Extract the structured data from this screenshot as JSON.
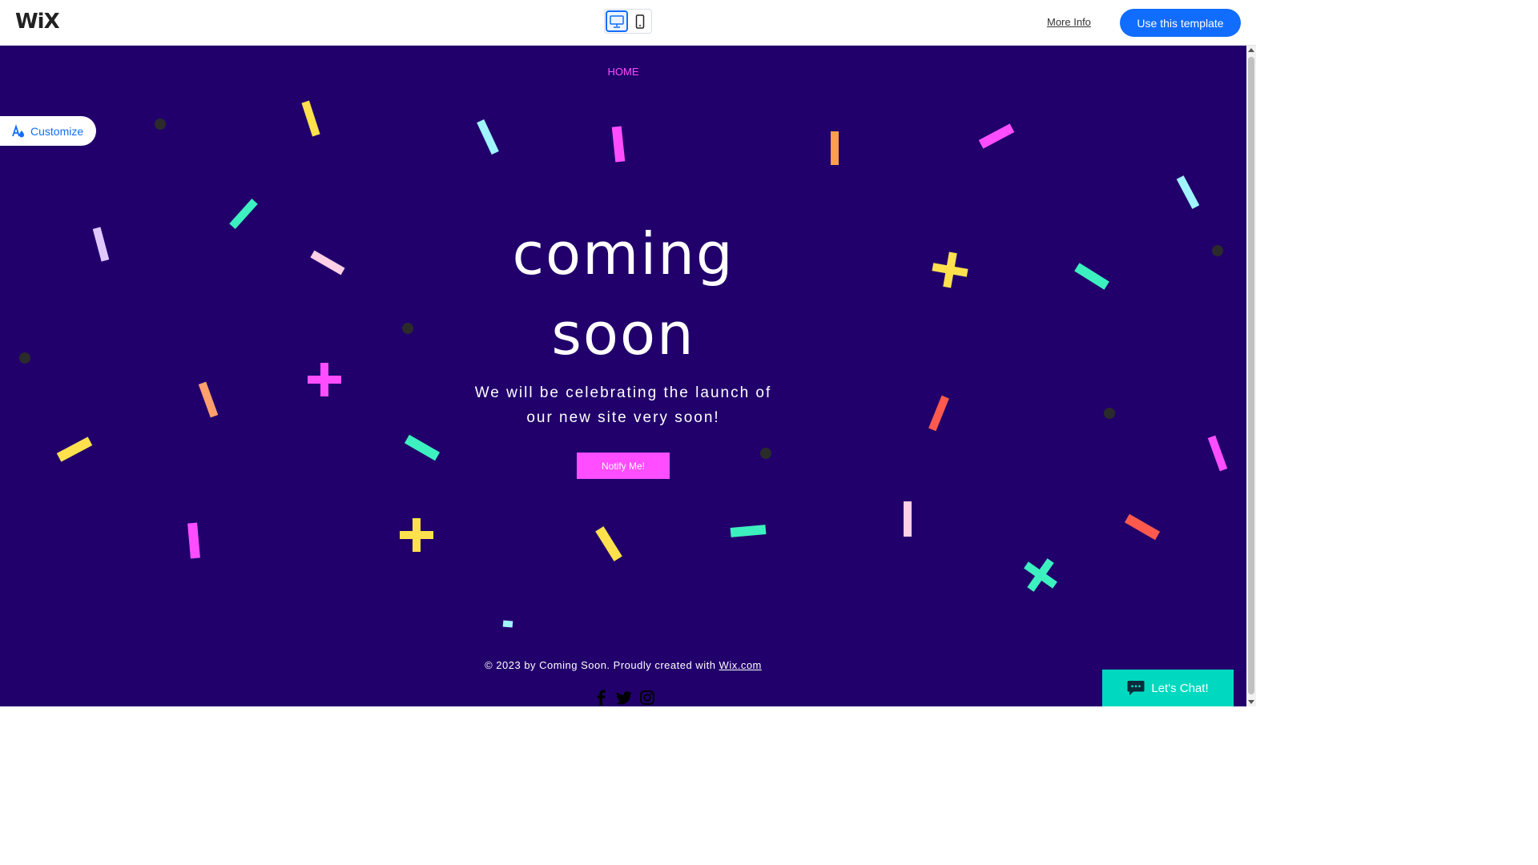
{
  "editor_bar": {
    "logo": "WiX",
    "more_info": "More Info",
    "use_template": "Use this template",
    "device_toggle": [
      "desktop",
      "mobile"
    ]
  },
  "site": {
    "nav": {
      "home": "HOME"
    },
    "customize": "Customize",
    "headline": [
      "coming",
      "soon"
    ],
    "subtext": [
      "We will be celebrating the launch of",
      "our new site very soon!"
    ],
    "notify_button": "Notify Me!",
    "footer": {
      "text": "© 2023 by Coming Soon. Proudly created with ",
      "link": "Wix.com"
    },
    "social": [
      "facebook-icon",
      "twitter-icon",
      "instagram-icon"
    ],
    "chat_button": "Let's Chat!"
  },
  "colors": {
    "background": "#21006b",
    "accent_pink": "#ff4dff",
    "wix_blue": "#116dff",
    "chat_teal": "#00d9c0"
  }
}
